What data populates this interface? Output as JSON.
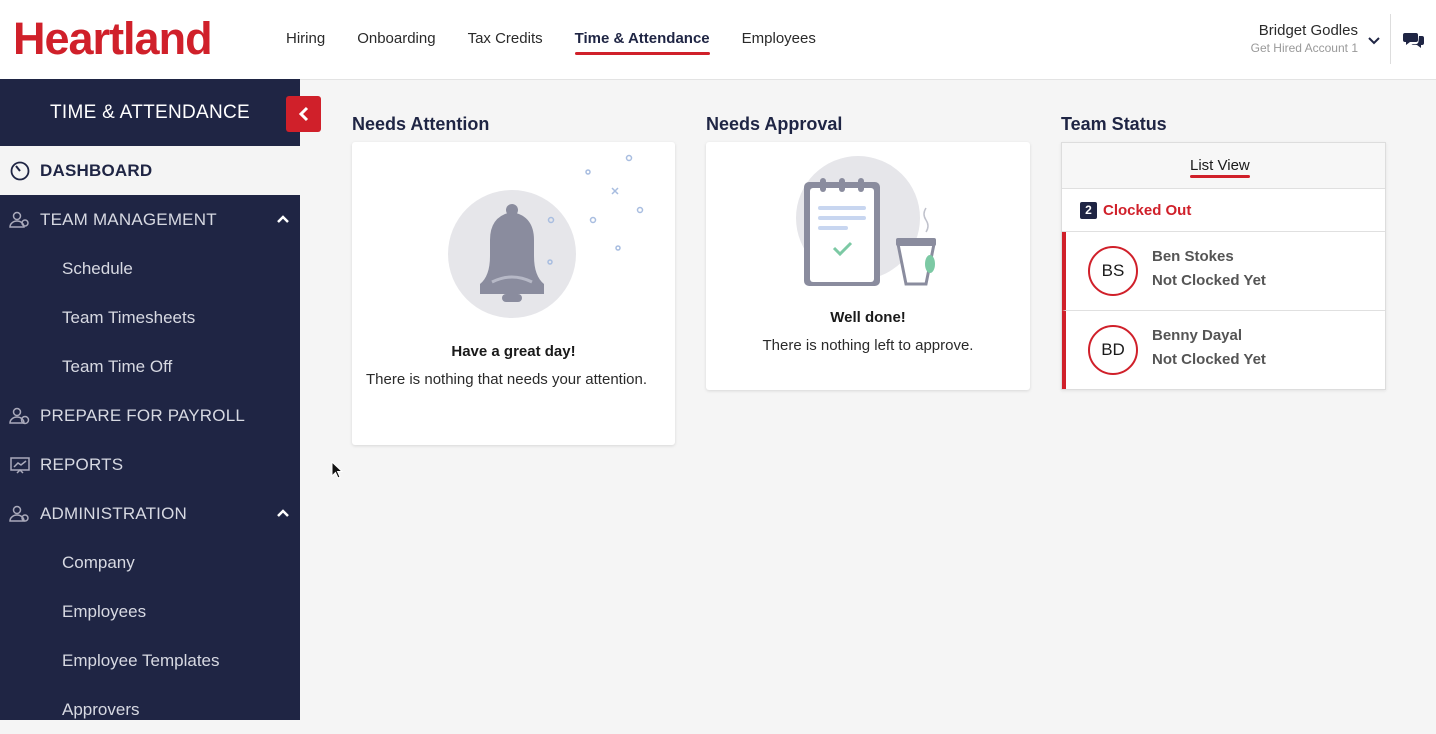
{
  "brand": {
    "logo_text": "Heartland",
    "color": "#d0202a"
  },
  "nav": {
    "items": [
      {
        "label": "Hiring"
      },
      {
        "label": "Onboarding"
      },
      {
        "label": "Tax Credits"
      },
      {
        "label": "Time & Attendance",
        "active": true
      },
      {
        "label": "Employees"
      }
    ]
  },
  "user": {
    "name": "Bridget Godles",
    "account": "Get Hired Account 1"
  },
  "sidebar": {
    "title": "TIME & ATTENDANCE",
    "items": [
      {
        "label": "DASHBOARD",
        "icon": "dashboard-gauge-icon"
      },
      {
        "label": "TEAM MANAGEMENT",
        "icon": "team-icon"
      },
      {
        "label": "Schedule"
      },
      {
        "label": "Team Timesheets"
      },
      {
        "label": "Team Time Off"
      },
      {
        "label": "PREPARE FOR PAYROLL",
        "icon": "payroll-icon"
      },
      {
        "label": "REPORTS",
        "icon": "reports-icon"
      },
      {
        "label": "ADMINISTRATION",
        "icon": "admin-icon"
      },
      {
        "label": "Company"
      },
      {
        "label": "Employees"
      },
      {
        "label": "Employee Templates"
      },
      {
        "label": "Approvers"
      }
    ]
  },
  "attention": {
    "title": "Needs Attention",
    "card_title": "Have a great day!",
    "card_text": "There is nothing that needs your attention."
  },
  "approval": {
    "title": "Needs Approval",
    "card_title": "Well done!",
    "card_text": "There is nothing left to approve."
  },
  "team_status": {
    "title": "Team Status",
    "tab": "List View",
    "group": {
      "count": "2",
      "label": "Clocked Out"
    },
    "members": [
      {
        "initials": "BS",
        "name": "Ben Stokes",
        "status": "Not Clocked Yet"
      },
      {
        "initials": "BD",
        "name": "Benny Dayal",
        "status": "Not Clocked Yet"
      }
    ]
  }
}
